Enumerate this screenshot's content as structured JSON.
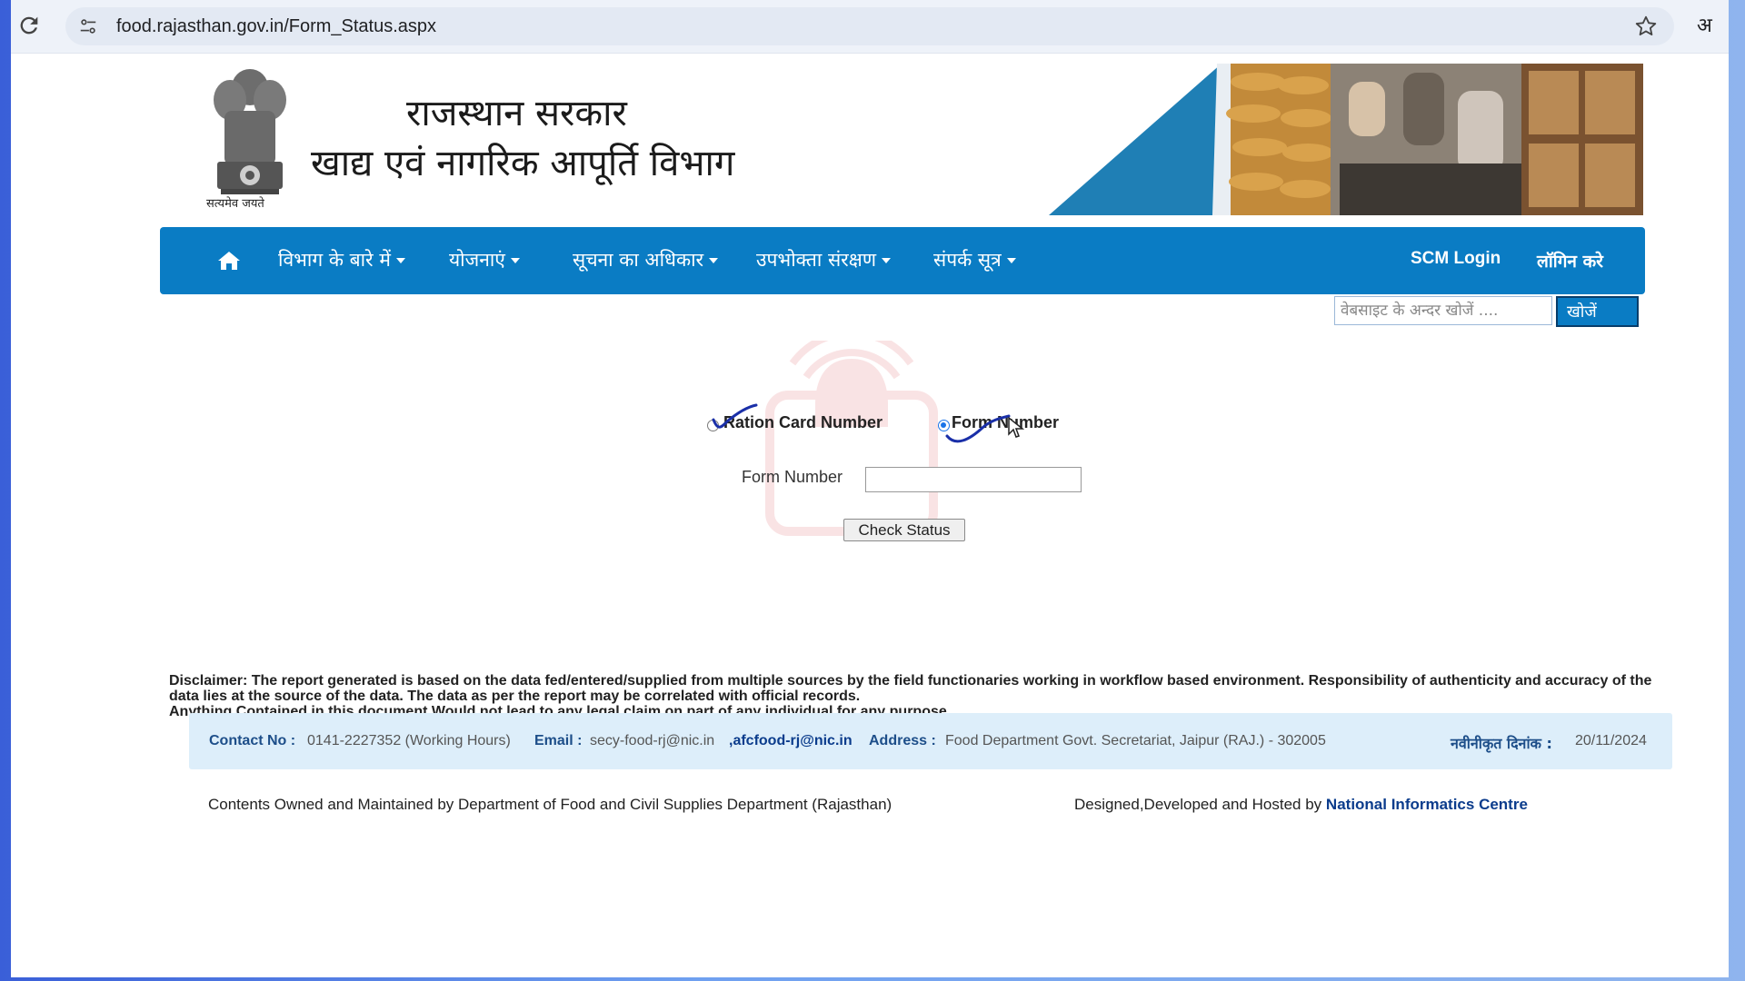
{
  "browser": {
    "url": "food.rajasthan.gov.in/Form_Status.aspx",
    "translate_glyph": "अ"
  },
  "header": {
    "gov_title": "राजस्थान सरकार",
    "dept_title": "खाद्य एवं नागरिक आपूर्ति विभाग",
    "emblem_motto": "सत्यमेव जयते"
  },
  "nav": {
    "items": [
      {
        "label": "विभाग के बारे में"
      },
      {
        "label": "योजनाएं"
      },
      {
        "label": "सूचना का अधिकार"
      },
      {
        "label": "उपभोक्ता संरक्षण"
      },
      {
        "label": "संपर्क सूत्र"
      }
    ],
    "scm_login": "SCM Login",
    "login": "लॉगिन करे"
  },
  "search": {
    "placeholder": "वेबसाइट के अन्दर खोजें ....",
    "button": "खोजें"
  },
  "form": {
    "option_ration": "Ration Card Number",
    "option_form": "Form Number",
    "selected_option": "Form Number",
    "field_label": "Form Number",
    "field_value": "",
    "submit": "Check Status"
  },
  "disclaimer": {
    "line1": "Disclaimer: The report generated is based on the data fed/entered/supplied from multiple sources by the field functionaries working in workflow based environment. Responsibility of authenticity and accuracy of the data lies at the source of the data. The data as per the report may be correlated with official records.",
    "line2": "Anything Contained in this document Would not lead to any legal claim on part of any individual for any purpose."
  },
  "contact": {
    "contact_label": "Contact No :",
    "contact_value": "0141-2227352 (Working Hours)",
    "email_label": "Email :",
    "email_value": "secy-food-rj@nic.in",
    "email_link": ",afcfood-rj@nic.in",
    "address_label": "Address :",
    "address_value": "Food Department Govt. Secretariat, Jaipur (RAJ.) - 302005",
    "updated_label": "नवीनीकृत दिनांक :",
    "updated_value": "20/11/2024"
  },
  "footer": {
    "owned": "Contents Owned and Maintained by Department of Food and Civil Supplies Department (Rajasthan)",
    "designed_prefix": "Designed,Developed and Hosted by",
    "designed_link": "National Informatics Centre"
  },
  "colors": {
    "nav_bg": "#0a7cc4",
    "contact_bg": "#ddeefa",
    "link": "#0b3c8c",
    "radio_accent": "#1a73e8"
  },
  "icons": [
    "reload-icon",
    "site-info-icon",
    "star-icon",
    "home-icon",
    "cursor-icon"
  ]
}
